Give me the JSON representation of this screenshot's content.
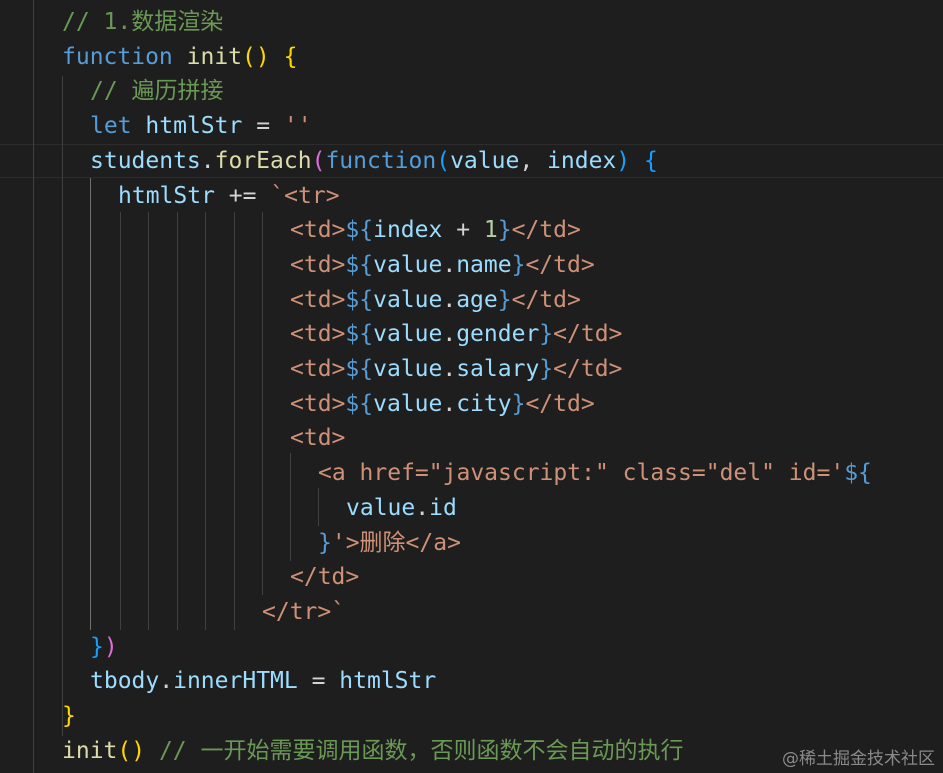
{
  "colors": {
    "background": "#1e1e1e",
    "keyword": "#569cd6",
    "function": "#dcdcaa",
    "variable": "#9cdcfe",
    "comment": "#6a9955",
    "string": "#ce9178",
    "number": "#b5cea8",
    "bracket_level1": "#ffd700",
    "bracket_level2": "#da70d6",
    "bracket_level3": "#179fff"
  },
  "code": {
    "lines": [
      [
        {
          "t": "// 1.数据渲染",
          "c": "cmt"
        }
      ],
      [
        {
          "t": "function",
          "c": "kw"
        },
        {
          "t": " ",
          "c": "plain"
        },
        {
          "t": "init",
          "c": "fn"
        },
        {
          "t": "()",
          "c": "b1"
        },
        {
          "t": " ",
          "c": "plain"
        },
        {
          "t": "{",
          "c": "b1"
        }
      ],
      [
        {
          "t": "// 遍历拼接",
          "c": "cmt"
        }
      ],
      [
        {
          "t": "let",
          "c": "kw"
        },
        {
          "t": " ",
          "c": "plain"
        },
        {
          "t": "htmlStr",
          "c": "var"
        },
        {
          "t": " = ",
          "c": "plain"
        },
        {
          "t": "''",
          "c": "str"
        }
      ],
      [
        {
          "t": "students",
          "c": "var"
        },
        {
          "t": ".",
          "c": "plain"
        },
        {
          "t": "forEach",
          "c": "fn"
        },
        {
          "t": "(",
          "c": "b2"
        },
        {
          "t": "function",
          "c": "kw"
        },
        {
          "t": "(",
          "c": "b3"
        },
        {
          "t": "value",
          "c": "var"
        },
        {
          "t": ", ",
          "c": "plain"
        },
        {
          "t": "index",
          "c": "var"
        },
        {
          "t": ")",
          "c": "b3"
        },
        {
          "t": " ",
          "c": "plain"
        },
        {
          "t": "{",
          "c": "b3"
        }
      ],
      [
        {
          "t": "htmlStr",
          "c": "var"
        },
        {
          "t": " += ",
          "c": "plain"
        },
        {
          "t": "`<tr>",
          "c": "str"
        }
      ],
      [
        {
          "t": "<td>",
          "c": "str"
        },
        {
          "t": "${",
          "c": "tpl"
        },
        {
          "t": "index",
          "c": "var"
        },
        {
          "t": " + ",
          "c": "plain"
        },
        {
          "t": "1",
          "c": "num"
        },
        {
          "t": "}",
          "c": "tpl"
        },
        {
          "t": "</td>",
          "c": "str"
        }
      ],
      [
        {
          "t": "<td>",
          "c": "str"
        },
        {
          "t": "${",
          "c": "tpl"
        },
        {
          "t": "value",
          "c": "var"
        },
        {
          "t": ".",
          "c": "plain"
        },
        {
          "t": "name",
          "c": "var"
        },
        {
          "t": "}",
          "c": "tpl"
        },
        {
          "t": "</td>",
          "c": "str"
        }
      ],
      [
        {
          "t": "<td>",
          "c": "str"
        },
        {
          "t": "${",
          "c": "tpl"
        },
        {
          "t": "value",
          "c": "var"
        },
        {
          "t": ".",
          "c": "plain"
        },
        {
          "t": "age",
          "c": "var"
        },
        {
          "t": "}",
          "c": "tpl"
        },
        {
          "t": "</td>",
          "c": "str"
        }
      ],
      [
        {
          "t": "<td>",
          "c": "str"
        },
        {
          "t": "${",
          "c": "tpl"
        },
        {
          "t": "value",
          "c": "var"
        },
        {
          "t": ".",
          "c": "plain"
        },
        {
          "t": "gender",
          "c": "var"
        },
        {
          "t": "}",
          "c": "tpl"
        },
        {
          "t": "</td>",
          "c": "str"
        }
      ],
      [
        {
          "t": "<td>",
          "c": "str"
        },
        {
          "t": "${",
          "c": "tpl"
        },
        {
          "t": "value",
          "c": "var"
        },
        {
          "t": ".",
          "c": "plain"
        },
        {
          "t": "salary",
          "c": "var"
        },
        {
          "t": "}",
          "c": "tpl"
        },
        {
          "t": "</td>",
          "c": "str"
        }
      ],
      [
        {
          "t": "<td>",
          "c": "str"
        },
        {
          "t": "${",
          "c": "tpl"
        },
        {
          "t": "value",
          "c": "var"
        },
        {
          "t": ".",
          "c": "plain"
        },
        {
          "t": "city",
          "c": "var"
        },
        {
          "t": "}",
          "c": "tpl"
        },
        {
          "t": "</td>",
          "c": "str"
        }
      ],
      [
        {
          "t": "<td>",
          "c": "str"
        }
      ],
      [
        {
          "t": "<a href=\"javascript:\" class=\"del\" id='",
          "c": "str"
        },
        {
          "t": "${",
          "c": "tpl"
        }
      ],
      [
        {
          "t": "value",
          "c": "var"
        },
        {
          "t": ".",
          "c": "plain"
        },
        {
          "t": "id",
          "c": "var"
        }
      ],
      [
        {
          "t": "}",
          "c": "tpl"
        },
        {
          "t": "'>删除</a>",
          "c": "str"
        }
      ],
      [
        {
          "t": "</td>",
          "c": "str"
        }
      ],
      [
        {
          "t": "</tr>`",
          "c": "str"
        }
      ],
      [
        {
          "t": "}",
          "c": "b3"
        },
        {
          "t": ")",
          "c": "b2"
        }
      ],
      [
        {
          "t": "tbody",
          "c": "var"
        },
        {
          "t": ".",
          "c": "plain"
        },
        {
          "t": "innerHTML",
          "c": "var"
        },
        {
          "t": " = ",
          "c": "plain"
        },
        {
          "t": "htmlStr",
          "c": "var"
        }
      ],
      [
        {
          "t": "}",
          "c": "b1"
        }
      ],
      [
        {
          "t": "init",
          "c": "fn"
        },
        {
          "t": "()",
          "c": "b1"
        },
        {
          "t": " ",
          "c": "plain"
        },
        {
          "t": "// 一开始需要调用函数，否则函数不会自动的执行",
          "c": "cmt"
        }
      ]
    ]
  },
  "watermark": {
    "text": "@稀土掘金技术社区"
  }
}
